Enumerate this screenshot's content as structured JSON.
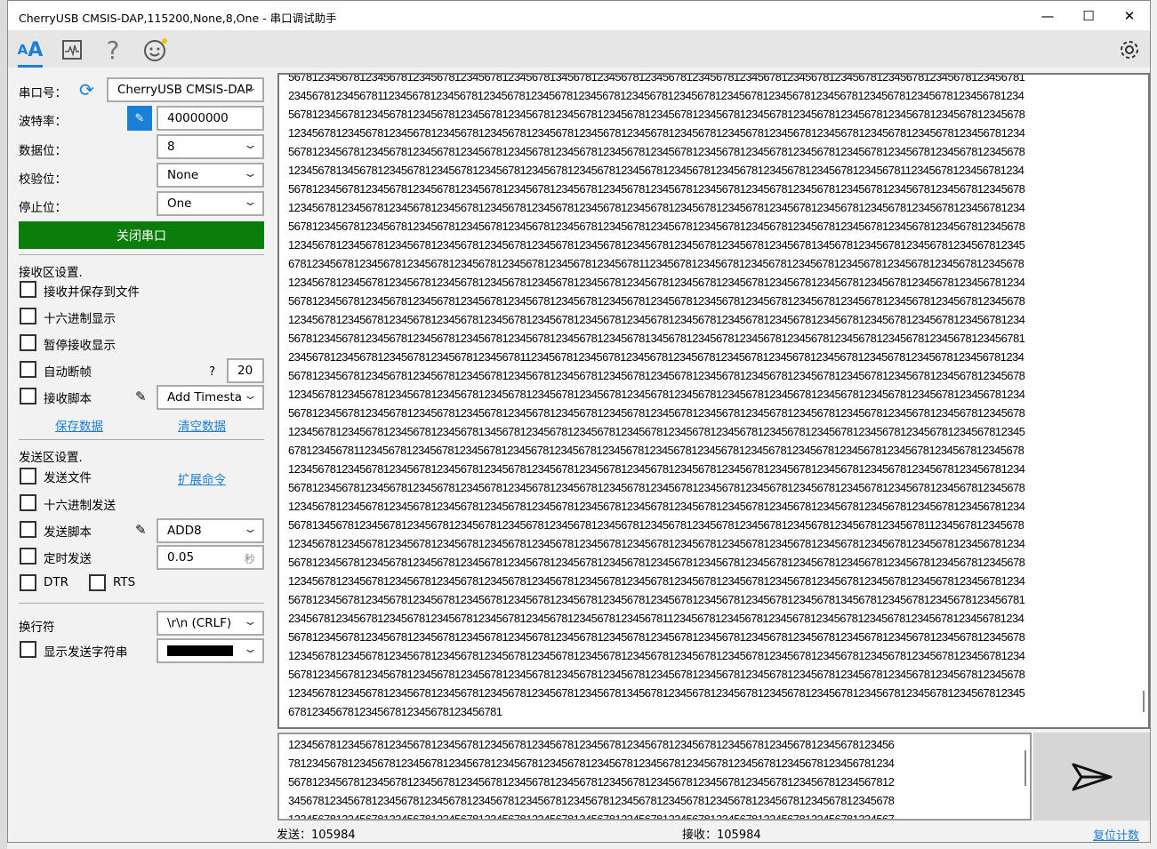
{
  "window": {
    "title": "CherryUSB CMSIS-DAP,115200,None,8,One - 串口调试助手"
  },
  "toolbar": {
    "icons": [
      "font-aa-icon",
      "waveform-icon",
      "help-icon",
      "smiley-icon"
    ],
    "settings": "gear-icon",
    "accent": "#1a7fd6"
  },
  "serial": {
    "port_label": "串口号：",
    "port_value": "CherryUSB CMSIS-DAP",
    "baud_label": "波特率：",
    "baud_value": "40000000",
    "databits_label": "数据位：",
    "databits_value": "8",
    "parity_label": "校验位：",
    "parity_value": "None",
    "stopbits_label": "停止位：",
    "stopbits_value": "One",
    "toggle_button": "关闭串口",
    "toggle_color": "#0b7d0b"
  },
  "receive_settings": {
    "title": "接收区设置.",
    "save_to_file": "接收并保存到文件",
    "hex_display": "十六进制显示",
    "pause_display": "暂停接收显示",
    "auto_frame": "自动断帧",
    "auto_frame_help": "?",
    "auto_frame_value": "20",
    "script": "接收脚本",
    "script_value": "Add Timesta",
    "save_data": "保存数据",
    "clear_data": "清空数据"
  },
  "send_settings": {
    "title": "发送区设置.",
    "send_file": "发送文件",
    "ext_cmd": "扩展命令",
    "hex_send": "十六进制发送",
    "script": "发送脚本",
    "script_value": "ADD8",
    "timed_send": "定时发送",
    "interval_value": "0.05",
    "interval_unit": "秒",
    "dtr": "DTR",
    "rts": "RTS",
    "newline_label": "换行符",
    "newline_value": "\\r\\n (CRLF)",
    "show_send_string": "显示发送字符串",
    "color_value": "#000000"
  },
  "receive_lines": [
    "5678123456781234567812345678123456781234567813456781234567812345678123456781234567812345678123456781234567812345678123456781",
    "2345678123456781123456781234567812345678123456781234567812345678123456781234567812345678123456781234567812345678123456781234",
    "5678123456781234567812345678123456781234567812345678123456781234567812345678123456781234567812345678123456781234567812345678",
    "1234567812345678123456781234567812345678123456781234567812345678123456781234567812345678123456781234567812345678123456781234",
    "5678123456781234567812345678123456781234567812345678123456781234567812345678123456781234567812345678123456781234567812345678",
    "1234567813456781234567812345678123456781234567812345678123456781234567812345678123456781234567812345678112345678123456781234",
    "5678123456781234567812345678123456781234567812345678123456781234567812345678123456781234567812345678123456781234567812345678",
    "1234567812345678123456781234567812345678123456781234567812345678123456781234567812345678123456781234567812345678123456781234",
    "5678123456781234567812345678123456781234567812345678123456781234567812345678123456781234567812345678123456781234567812345678",
    "1234567812345678123456781234567812345678123456781234567812345678123456781234567812345678134567812345678123456781234567812345",
    "6781234567812345678123456781234567812345678123456781234567811234567812345678123456781234567812345678123456781234567812345678",
    "1234567812345678123456781234567812345678123456781234567812345678123456781234567812345678123456781234567812345678123456781234",
    "5678123456781234567812345678123456781234567812345678123456781234567812345678123456781234567812345678123456781234567812345678",
    "1234567812345678123456781234567812345678123456781234567812345678123456781234567812345678123456781234567812345678123456781234",
    "5678123456781234567812345678123456781234567812345678123456781345678123456781234567812345678123456781234567812345678123456781",
    "2345678123456781234567812345678123456781123456781234567812345678123456781234567812345678123456781234567812345678123456781234",
    "5678123456781234567812345678123456781234567812345678123456781234567812345678123456781234567812345678123456781234567812345678",
    "1234567812345678123456781234567812345678123456781234567812345678123456781234567812345678123456781234567812345678123456781234",
    "5678123456781234567812345678123456781234567812345678123456781234567812345678123456781234567812345678123456781234567812345678",
    "1234567812345678123456781234567813456781234567812345678123456781234567812345678123456781234567812345678123456781234567812345",
    "6781234567811234567812345678123456781234567812345678123456781234567812345678123456781234567812345678123456781234567812345678",
    "1234567812345678123456781234567812345678123456781234567812345678123456781234567812345678123456781234567812345678123456781234",
    "5678123456781234567812345678123456781234567812345678123456781234567812345678123456781234567812345678123456781234567812345678",
    "1234567812345678123456781234567812345678123456781234567812345678123456781234567812345678123456781234567812345678123456781234",
    "5678134567812345678123456781234567812345678123456781234567812345678123456781234567812345678123456781234567811234567812345678",
    "1234567812345678123456781234567812345678123456781234567812345678123456781234567812345678123456781234567812345678123456781234",
    "5678123456781234567812345678123456781234567812345678123456781234567812345678123456781234567812345678123456781234567812345678",
    "1234567812345678123456781234567812345678123456781234567812345678123456781234567812345678123456781234567812345678123456781234",
    "5678123456781234567812345678123456781234567812345678123456781234567812345678123456781234567813456781234567812345678123456781",
    "2345678123456781234567812345678123456781234567812345678123456781123456781234567812345678123456781234567812345678123456781234",
    "5678123456781234567812345678123456781234567812345678123456781234567812345678123456781234567812345678123456781234567812345678",
    "1234567812345678123456781234567812345678123456781234567812345678123456781234567812345678123456781234567812345678123456781234",
    "5678123456781234567812345678123456781234567812345678123456781234567812345678123456781234567812345678123456781234567812345678",
    "1234567812345678123456781234567812345678123456781234567813456781234567812345678123456781234567812345678123456781234567812345",
    "678123456781234567812345678123456781"
  ],
  "send_lines": [
    "123456781234567812345678123456781234567812345678123456781234567812345678123456781234567812345678123456",
    "781234567812345678123456781234567812345678123456781234567812345678123456781234567812345678123456781234",
    "567812345678123456781234567812345678123456781234567812345678123456781234567812345678123456781234567812",
    "345678123456781234567812345678123456781234567812345678123456781234567812345678123456781234567812345678",
    "123456781234567812345678123456781234567812345678134567812345678123456781234567812345678123456781234567"
  ],
  "status": {
    "sent": "发送：105984",
    "received": "接收：105984",
    "reset": "复位计数"
  }
}
